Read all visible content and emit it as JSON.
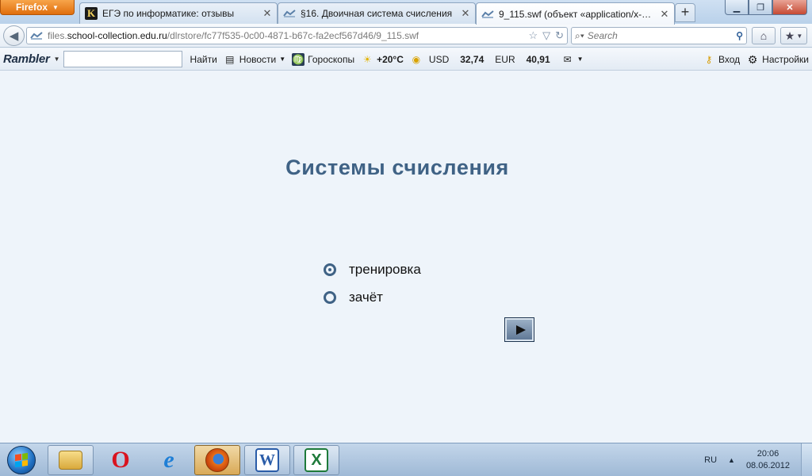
{
  "browser": {
    "app_button": "Firefox",
    "tabs": [
      {
        "label": "ЕГЭ по информатике: отзывы",
        "favicon": "k-logo-icon",
        "active": false
      },
      {
        "label": "§16. Двоичная система счисления",
        "favicon": "school-collection-icon",
        "active": false
      },
      {
        "label": "9_115.swf (объект «application/x-sho...",
        "favicon": "school-collection-icon",
        "active": true
      }
    ],
    "new_tab": "+",
    "url_prefix": "files.",
    "url_host": "school-collection.edu.ru",
    "url_path": "/dlrstore/fc77f535-0c00-4871-b67c-fa2ecf567d46/9_115.swf",
    "search_placeholder": "Search"
  },
  "rambler": {
    "logo": "Rambler",
    "find_label": "Найти",
    "news_label": "Новости",
    "horoscope_label": "Гороскопы",
    "weather": "+20°C",
    "usd_label": "USD",
    "usd_value": "32,74",
    "eur_label": "EUR",
    "eur_value": "40,91",
    "login_label": "Вход",
    "settings_label": "Настройки"
  },
  "page": {
    "title": "Системы счисления",
    "options": [
      {
        "label": "тренировка",
        "selected": true
      },
      {
        "label": "зачёт",
        "selected": false
      }
    ],
    "accent_color": "#3f6285"
  },
  "taskbar": {
    "apps": [
      "explorer-icon",
      "opera-icon",
      "internet-explorer-icon",
      "firefox-icon",
      "word-icon",
      "excel-icon"
    ],
    "language": "RU",
    "time": "20:06",
    "date": "08.06.2012"
  }
}
